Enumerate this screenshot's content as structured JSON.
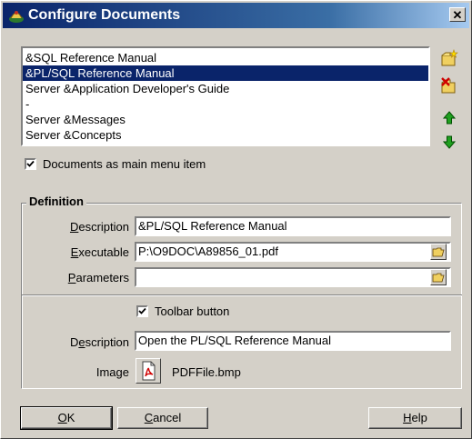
{
  "window": {
    "title": "Configure Documents"
  },
  "documents": [
    "&SQL Reference Manual",
    "&PL/SQL Reference Manual",
    "Server &Application Developer's Guide",
    "-",
    "Server &Messages",
    "Server &Concepts"
  ],
  "main_menu_checkbox": {
    "label": "Documents as main menu item",
    "checked": true
  },
  "definition": {
    "title": "Definition",
    "description_label": "Description",
    "description_value": "&PL/SQL Reference Manual",
    "executable_label": "Executable",
    "executable_value": "P:\\O9DOC\\A89856_01.pdf",
    "parameters_label": "Parameters",
    "parameters_value": "",
    "toolbar_checkbox_label": "Toolbar button",
    "toolbar_checked": true,
    "toolbar_description_label": "Description",
    "toolbar_description_value": "Open the PL/SQL Reference Manual",
    "image_label": "Image",
    "image_value": "PDFFile.bmp"
  },
  "buttons": {
    "ok": "OK",
    "cancel": "Cancel",
    "help": "Help"
  },
  "icons": {
    "title": "oracle-app-icon",
    "new": "new-document-icon",
    "delete": "delete-document-icon",
    "up": "move-up-arrow-icon",
    "down": "move-down-arrow-icon",
    "browse": "folder-open-icon",
    "pdf": "pdf-file-icon"
  },
  "colors": {
    "selection": "#0a246a",
    "arrows": "#008000"
  }
}
